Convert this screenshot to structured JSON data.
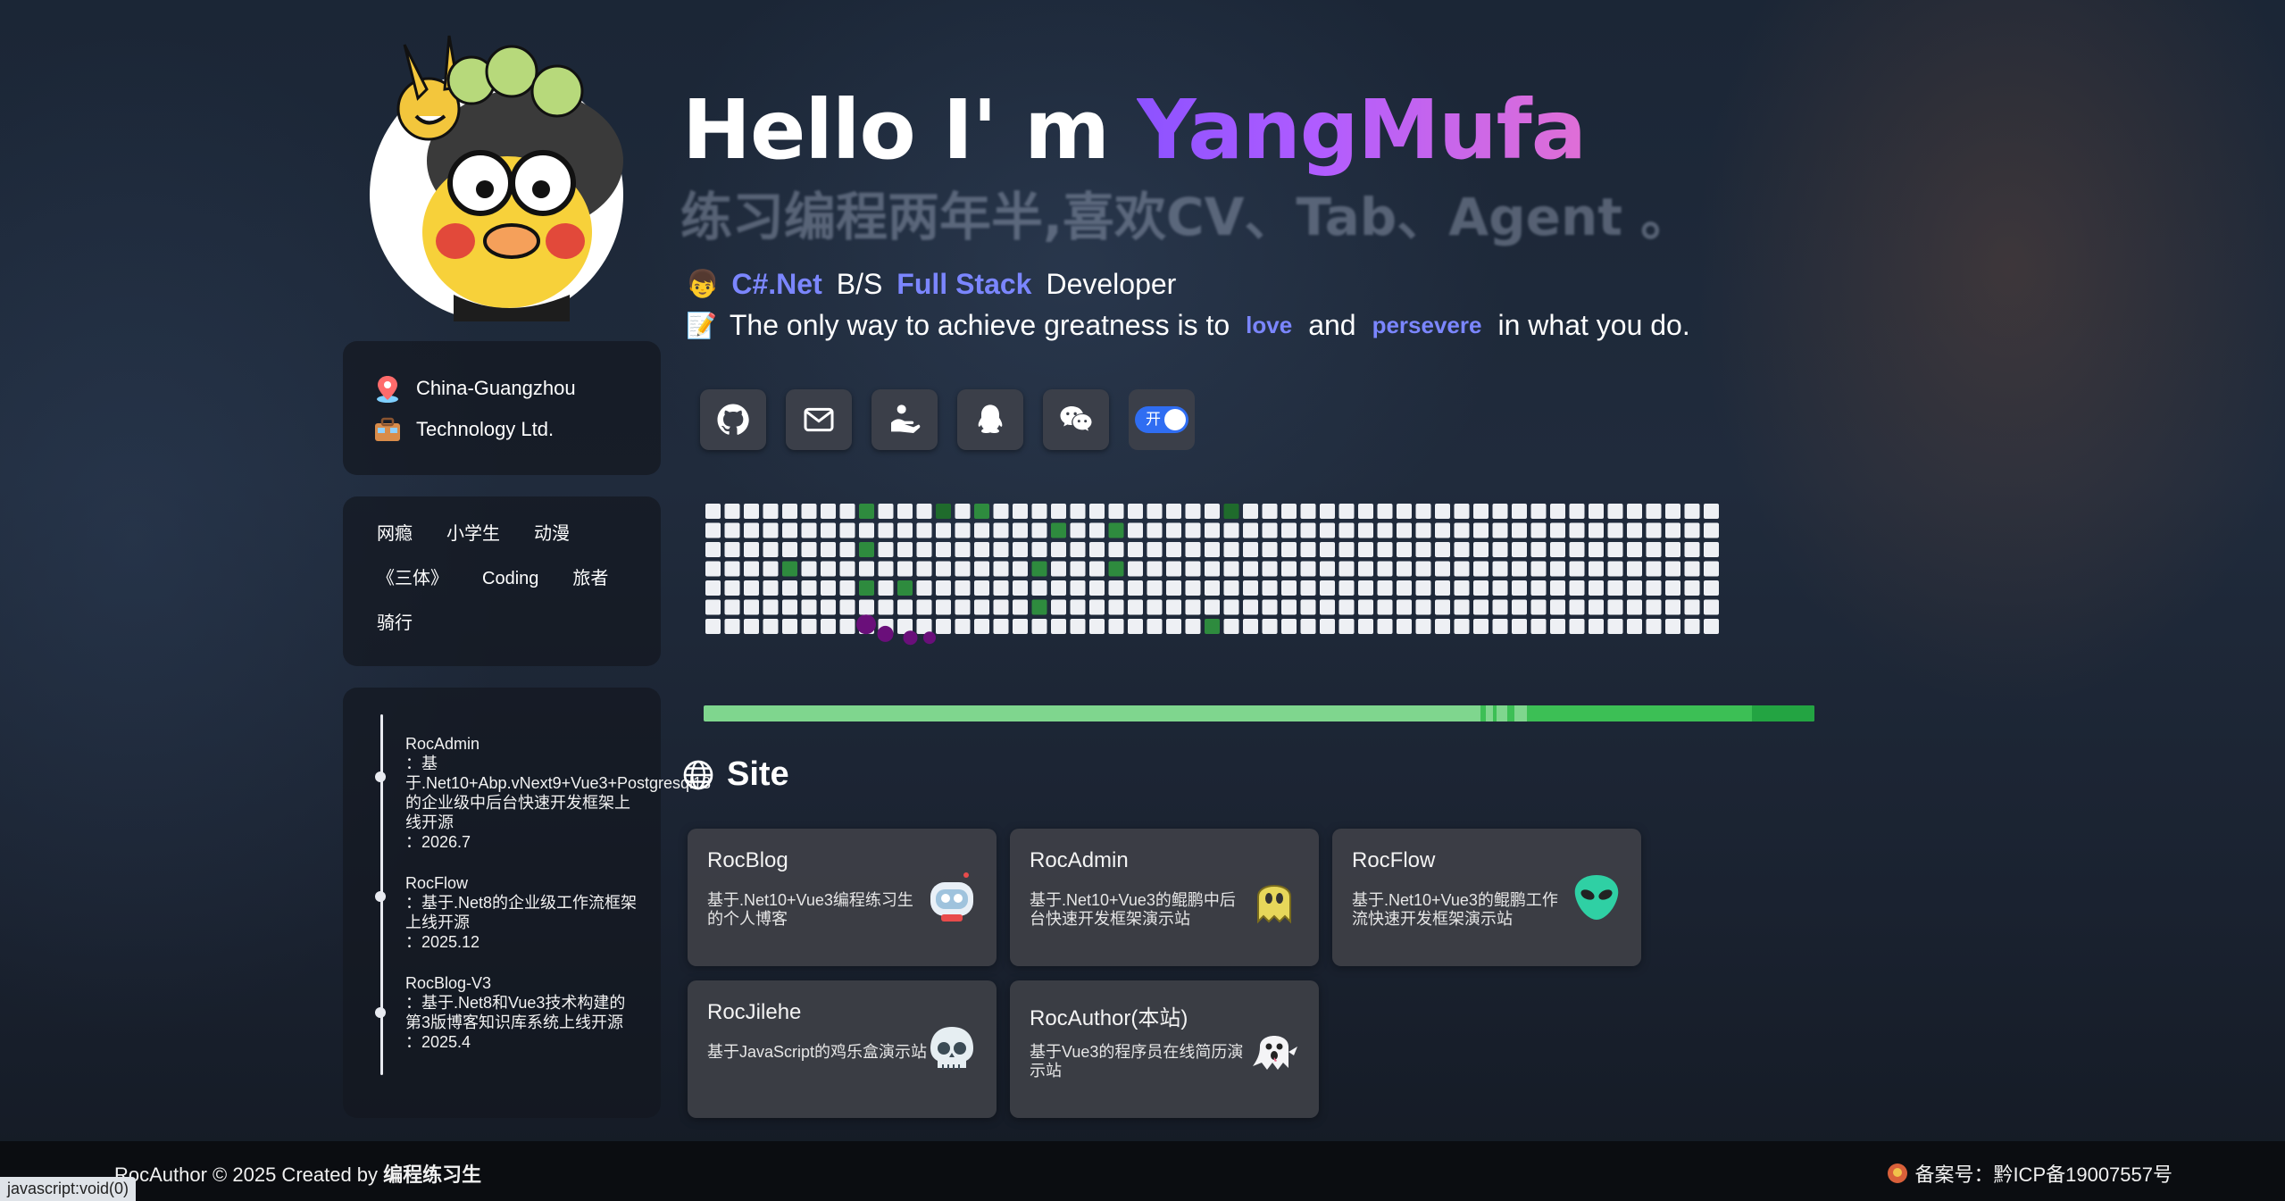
{
  "hero": {
    "greeting": "Hello I' m ",
    "name": "YangMufa",
    "motto": "练习编程两年半,喜欢CV、Tab、Agent 。",
    "role": {
      "tech": "C#.Net",
      "bs": "B/S",
      "stack": "Full Stack",
      "title": "Developer"
    },
    "quote": {
      "pre": "The only way to achieve greatness is to",
      "w1": "love",
      "mid": "and",
      "w2": "persevere",
      "post": "in what you do."
    }
  },
  "social": {
    "items": [
      "github-icon",
      "mail-icon",
      "donate-icon",
      "qq-icon",
      "wechat-icon"
    ],
    "toggle_label": "开"
  },
  "profile": {
    "location": "China-Guangzhou",
    "company": "Technology Ltd."
  },
  "tags": [
    "网瘾",
    "小学生",
    "动漫",
    "《三体》",
    "Coding",
    "旅者",
    "骑行"
  ],
  "timeline": [
    {
      "title": "RocAdmin",
      "desc": "：基于.Net10+Abp.vNext9+Vue3+Postgresql18的企业级中后台快速开发框架上线开源",
      "date": "：2026.7"
    },
    {
      "title": "RocFlow",
      "desc": "：基于.Net8的企业级工作流框架上线开源",
      "date": "：2025.12"
    },
    {
      "title": "RocBlog-V3",
      "desc": "：基于.Net8和Vue3技术构建的第3版博客知识库系统上线开源",
      "date": "：2025.4"
    }
  ],
  "contributions": {
    "weeks": 53,
    "days": 7,
    "colors": {
      "empty": "#eef0f4",
      "level1": "#2e8b3e",
      "level2": "#1f6b2c",
      "snake": "#6a0f7a"
    },
    "filled_level1": [
      [
        8,
        0
      ],
      [
        12,
        0
      ],
      [
        14,
        0
      ],
      [
        27,
        0
      ],
      [
        18,
        1
      ],
      [
        21,
        1
      ],
      [
        8,
        2
      ],
      [
        4,
        3
      ],
      [
        17,
        3
      ],
      [
        21,
        3
      ],
      [
        8,
        4
      ],
      [
        10,
        4
      ],
      [
        17,
        5
      ],
      [
        26,
        6
      ]
    ],
    "filled_level2": [
      [
        12,
        0
      ],
      [
        27,
        0
      ]
    ]
  },
  "progress": {
    "colors": {
      "base": "#7fd68e",
      "mid": "#3cbf55",
      "end": "#23a442"
    }
  },
  "site": {
    "title": "Site",
    "cards": [
      {
        "name": "RocBlog",
        "desc": "基于.Net10+Vue3编程练习生的个人博客",
        "icon": "robot-icon"
      },
      {
        "name": "RocAdmin",
        "desc": "基于.Net10+Vue3的鲲鹏中后台快速开发框架演示站",
        "icon": "ghost-yellow-icon"
      },
      {
        "name": "RocFlow",
        "desc": "基于.Net10+Vue3的鲲鹏工作流快速开发框架演示站",
        "icon": "alien-icon"
      },
      {
        "name": "RocJilehe",
        "desc": "基于JavaScript的鸡乐盒演示站",
        "icon": "skull-icon"
      },
      {
        "name": "RocAuthor(本站)",
        "desc": "基于Vue3的程序员在线简历演示站",
        "icon": "ghost-icon"
      }
    ]
  },
  "footer": {
    "copyright_pre": "RocAuthor © 2025 Created by ",
    "author": "编程练习生",
    "icp": "备案号：黔ICP备19007557号"
  },
  "statusbar": "javascript:void(0)"
}
